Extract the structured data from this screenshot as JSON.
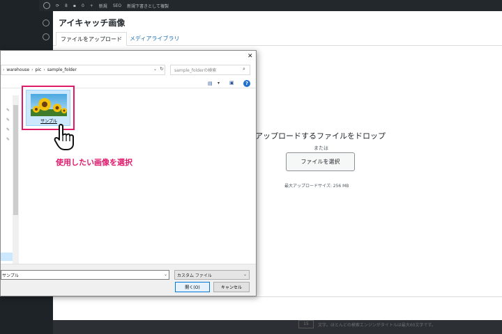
{
  "wp_admin_bar": {
    "updates_count": "8",
    "comments_count": "0",
    "new_label": "新規",
    "seo_label": "SEO",
    "save_draft_label": "新規下書きとして複製"
  },
  "media_modal": {
    "title": "アイキャッチ画像",
    "tabs": [
      {
        "label": "ファイルをアップロード",
        "active": true
      },
      {
        "label": "メディアライブラリ",
        "active": false
      }
    ],
    "drop_text": "アップロードするファイルをドロップ",
    "or_text": "または",
    "select_button": "ファイルを選択",
    "max_size": "最大アップロードサイズ: 256 MB"
  },
  "file_dialog": {
    "close_glyph": "✕",
    "breadcrumb": [
      "warehouse",
      "pic",
      "sample_folder"
    ],
    "search_placeholder": "sample_folderの検索",
    "file_item": {
      "label": "サンプル"
    },
    "filename_value": "サンプル",
    "filetype_value": "カスタム ファイル",
    "open_button": "開く(O)",
    "cancel_button": "キャンセル"
  },
  "annotation": {
    "callout_text": "使用したい画像を選択",
    "accent_color": "#e0196b"
  },
  "background_footer_text": "文字。ほとんどの検索エンジンがタイトルは最大60文字です。",
  "background_footer_field": "15"
}
